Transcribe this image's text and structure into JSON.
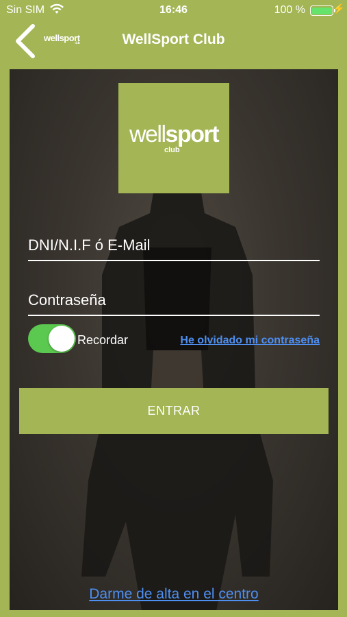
{
  "status_bar": {
    "carrier": "Sin SIM",
    "time": "16:46",
    "battery_percent": "100 %",
    "battery_level": 1.0,
    "icons": [
      "wifi-icon",
      "battery-icon",
      "charging-bolt-icon"
    ]
  },
  "nav": {
    "title": "WellSport Club",
    "back_icon": "chevron-left-icon",
    "logo_text": "wellsport",
    "logo_sub": "club"
  },
  "logo": {
    "text_light": "well",
    "text_bold": "sport",
    "sub": "club"
  },
  "form": {
    "username_placeholder": "DNI/N.I.F ó E-Mail",
    "password_placeholder": "Contraseña",
    "remember_label": "Recordar",
    "remember_on": true,
    "forgot_link": "He olvidado mi contraseña",
    "submit_label": "ENTRAR"
  },
  "footer": {
    "signup_link": "Darme de alta en el centro"
  },
  "colors": {
    "brand": "#a3b554",
    "toggle_on": "#5bc94f",
    "link": "#4e8ff2",
    "battery": "#66e36b"
  }
}
